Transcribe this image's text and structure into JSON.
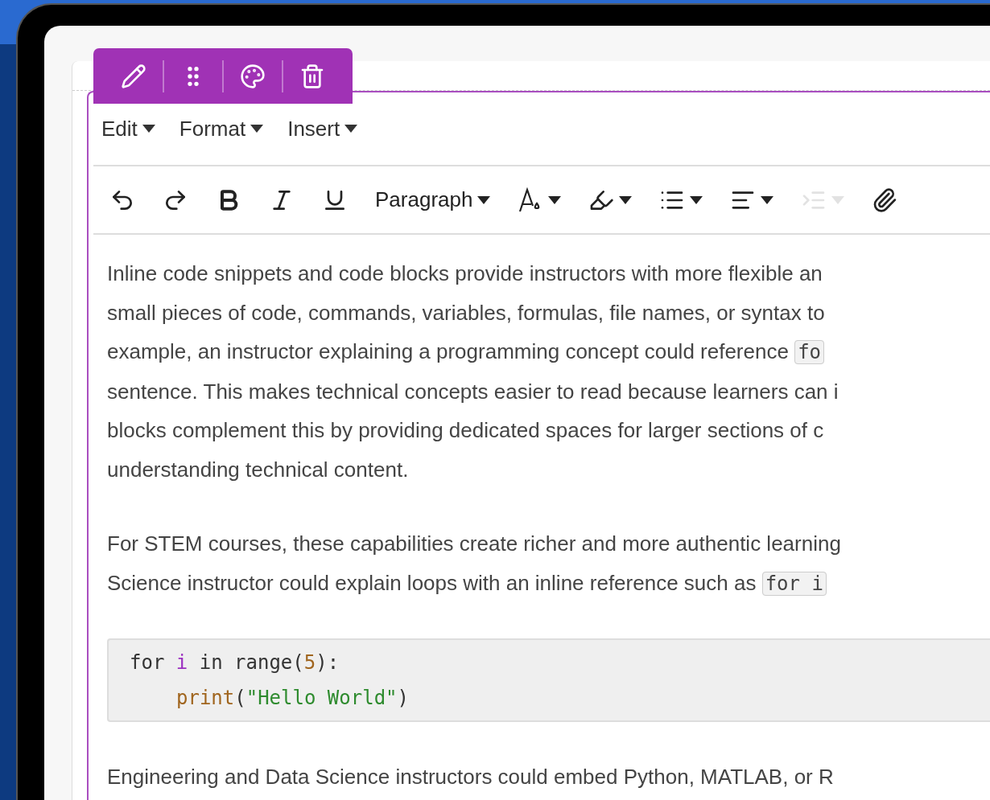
{
  "menu_bar": {
    "items": [
      "Edit",
      "Format",
      "Insert"
    ]
  },
  "toolbar": {
    "block_format": "Paragraph",
    "indent": {
      "disabled": true
    }
  },
  "content": [
    {
      "kind": "text",
      "lines": [
        {
          "text": "Inline code snippets and code blocks provide instructors with more flexible an"
        },
        {
          "text": "small pieces of code, commands, variables, formulas, file names, or syntax to"
        },
        {
          "text": "example, an instructor explaining a programming concept could reference ",
          "code": "fo"
        },
        {
          "text": "sentence. This makes technical concepts easier to read because learners can i"
        },
        {
          "text": "blocks complement this by providing dedicated spaces for larger sections of c"
        },
        {
          "text": "understanding technical content."
        }
      ]
    },
    {
      "kind": "text",
      "lines": [
        {
          "text": "For STEM courses, these capabilities create richer and more authentic learning"
        },
        {
          "text": "Science instructor could explain loops with an inline reference such as ",
          "code": "for i"
        }
      ]
    },
    {
      "kind": "code",
      "lines": [
        {
          "indent": false,
          "tokens": [
            {
              "kind": "plain",
              "text": "for "
            },
            {
              "kind": "variable",
              "text": "i"
            },
            {
              "kind": "plain",
              "text": " in range("
            },
            {
              "kind": "number",
              "text": "5"
            },
            {
              "kind": "plain",
              "text": "):"
            }
          ]
        },
        {
          "indent": true,
          "tokens": [
            {
              "kind": "function",
              "text": "print"
            },
            {
              "kind": "plain",
              "text": "("
            },
            {
              "kind": "string",
              "text": "\"Hello World\""
            },
            {
              "kind": "plain",
              "text": ")"
            }
          ]
        }
      ]
    },
    {
      "kind": "text",
      "lines": [
        {
          "text": "Engineering and Data Science instructors could embed Python, MATLAB, or R"
        }
      ]
    }
  ]
}
